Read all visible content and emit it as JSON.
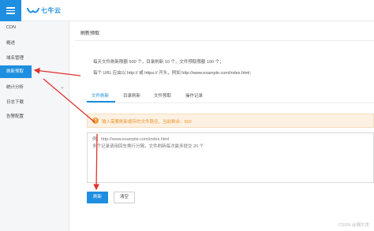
{
  "header": {
    "logo_text": "七牛云"
  },
  "sidebar": {
    "items": [
      {
        "label": "CDN"
      },
      {
        "label": "概述"
      },
      {
        "label": "域名管理"
      },
      {
        "label": "刷新预取",
        "active": true
      },
      {
        "label": "统计分析"
      },
      {
        "label": "日志下载"
      },
      {
        "label": "告警配置"
      }
    ]
  },
  "main": {
    "title": "刷新预取",
    "notes": [
      "每天文件刷新限额 500 个，目录刷新 10 个，文件预取限额 100 个；",
      "每个 URL 应由以 http:// 或 https:// 开头，例如 http://www.example.com/index.html;"
    ],
    "tabs": [
      {
        "label": "文件刷新",
        "active": true
      },
      {
        "label": "目录刷新"
      },
      {
        "label": "文件预取"
      },
      {
        "label": "操作记录"
      }
    ],
    "alert": {
      "icon": "!",
      "text": "输入需要刷新缓存的文件路径，当前剩余：500"
    },
    "textarea_placeholder": "例：http://www.example.com/index.html\n多个记录请用回车换行分隔，文件刷新每次最多提交 20 个",
    "buttons": {
      "refresh": "刷新",
      "clear": "清空"
    }
  },
  "watermark": "CSDN @偶尔贪",
  "colors": {
    "accent": "#1e8ee0",
    "warning": "#f0a03c",
    "annotation_arrow": "#e0342f"
  }
}
